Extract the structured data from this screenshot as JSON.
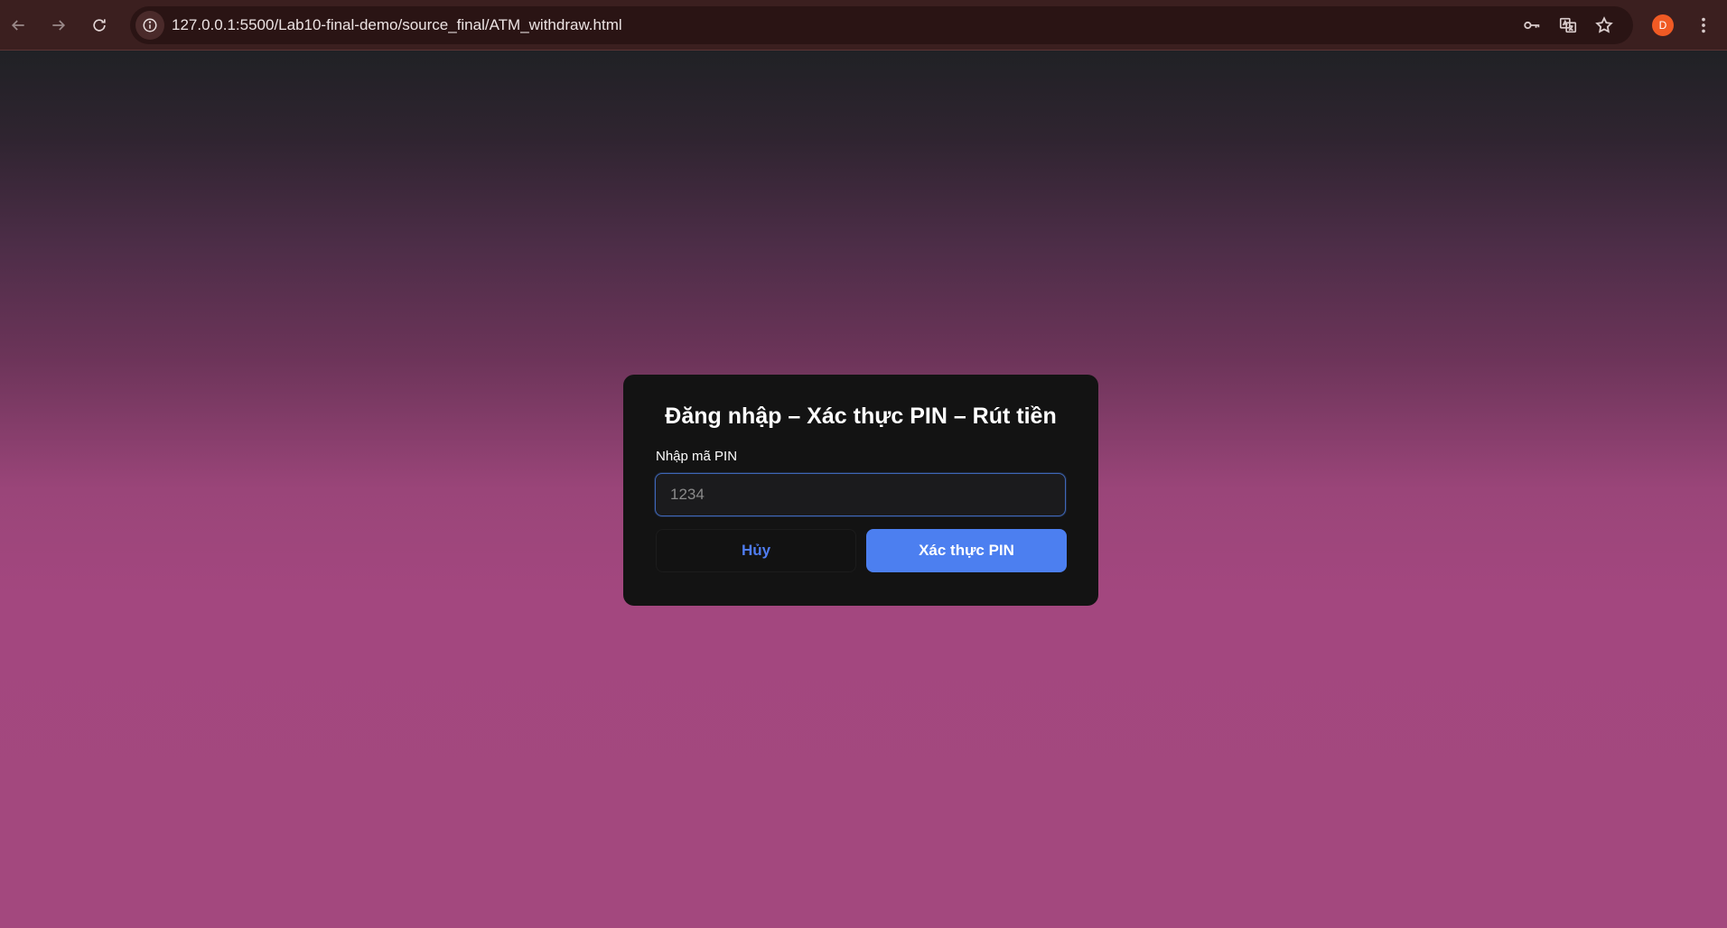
{
  "browser": {
    "url": "127.0.0.1:5500/Lab10-final-demo/source_final/ATM_withdraw.html",
    "profile_initial": "D",
    "icons": [
      "back-icon",
      "forward-icon",
      "reload-icon",
      "site-info-icon",
      "key-icon",
      "translate-icon",
      "star-icon",
      "more-vert-icon"
    ]
  },
  "card": {
    "title": "Đăng nhập – Xác thực PIN – Rút tiền",
    "pin_label": "Nhập mã PIN",
    "pin_placeholder": "1234",
    "pin_value": "",
    "cancel_label": "Hủy",
    "verify_label": "Xác thực PIN"
  },
  "colors": {
    "accent": "#4c7ff0",
    "card_background": "#131313",
    "page_gradient_top": "#202125",
    "page_gradient_bottom": "#a3487e",
    "browser_bar": "#3b1f1f",
    "profile_badge": "#f05a24"
  }
}
